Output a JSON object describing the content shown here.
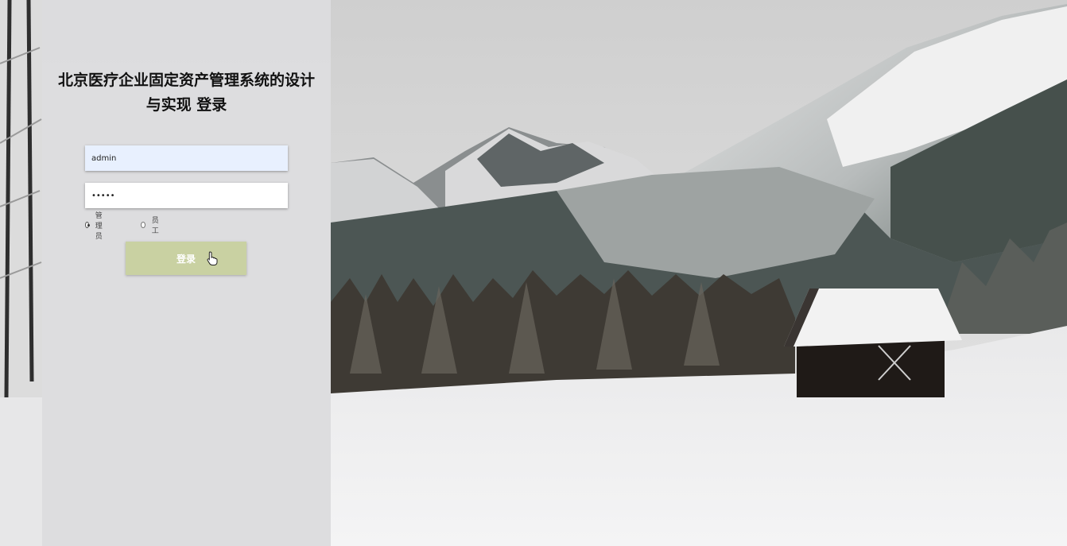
{
  "page": {
    "title_line1": "北京医疗企业固定资产管理系统的设计",
    "title_line2": "与实现 登录"
  },
  "form": {
    "username_value": "admin",
    "password_mask": "•••••",
    "roles": [
      {
        "label": "管理员",
        "checked": true
      },
      {
        "label": "员工",
        "checked": false
      }
    ],
    "login_label": "登录"
  },
  "theme": {
    "button_color": "#c9d1a2",
    "panel_color": "#dddddf"
  },
  "icons": {
    "cursor": "hand-pointer-icon"
  }
}
